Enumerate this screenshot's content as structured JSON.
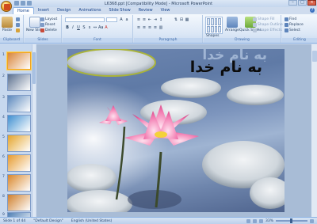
{
  "window": {
    "title": "L6368.ppt [Compatibility Mode] - Microsoft PowerPoint",
    "controls": [
      "minimize",
      "maximize",
      "close"
    ]
  },
  "ribbon": {
    "tabs": [
      {
        "label": "Home",
        "active": true
      },
      {
        "label": "Insert",
        "active": false
      },
      {
        "label": "Design",
        "active": false
      },
      {
        "label": "Animations",
        "active": false
      },
      {
        "label": "Slide Show",
        "active": false
      },
      {
        "label": "Review",
        "active": false
      },
      {
        "label": "View",
        "active": false
      }
    ],
    "clipboard": {
      "label": "Clipboard",
      "paste": "Paste"
    },
    "slides": {
      "label": "Slides",
      "new_slide": "New Slide",
      "layout": "Layout",
      "reset": "Reset",
      "delete": "Delete"
    },
    "font": {
      "label": "Font"
    },
    "paragraph": {
      "label": "Paragraph"
    },
    "drawing": {
      "label": "Drawing",
      "shapes": "Shapes",
      "arrange": "Arrange",
      "quick_styles": "Quick Styles",
      "shape_fill": "Shape Fill",
      "shape_outline": "Shape Outline",
      "shape_effects": "Shape Effects"
    },
    "editing": {
      "label": "Editing",
      "find": "Find",
      "replace": "Replace",
      "select": "Select"
    }
  },
  "thumbnails": [
    {
      "num": "1",
      "active": true,
      "color": "#d9863b"
    },
    {
      "num": "2",
      "active": false,
      "color": "#5a6f8e"
    },
    {
      "num": "3",
      "active": false,
      "color": "#5b88bd"
    },
    {
      "num": "4",
      "active": false,
      "color": "#3f8fd0"
    },
    {
      "num": "5",
      "active": false,
      "color": "#e4a42a"
    },
    {
      "num": "6",
      "active": false,
      "color": "#e69a2e"
    },
    {
      "num": "7",
      "active": false,
      "color": "#d9862a"
    },
    {
      "num": "8",
      "active": false,
      "color": "#cf7f2c"
    },
    {
      "num": "9",
      "active": false,
      "color": "#4f7fb4"
    }
  ],
  "slide": {
    "title": "به نام خدا",
    "watermark": "به نام خدا"
  },
  "statusbar": {
    "slide_info": "Slide 1 of 44",
    "theme": "\"Default Design\"",
    "language": "English (United States)",
    "zoom": "33%"
  }
}
